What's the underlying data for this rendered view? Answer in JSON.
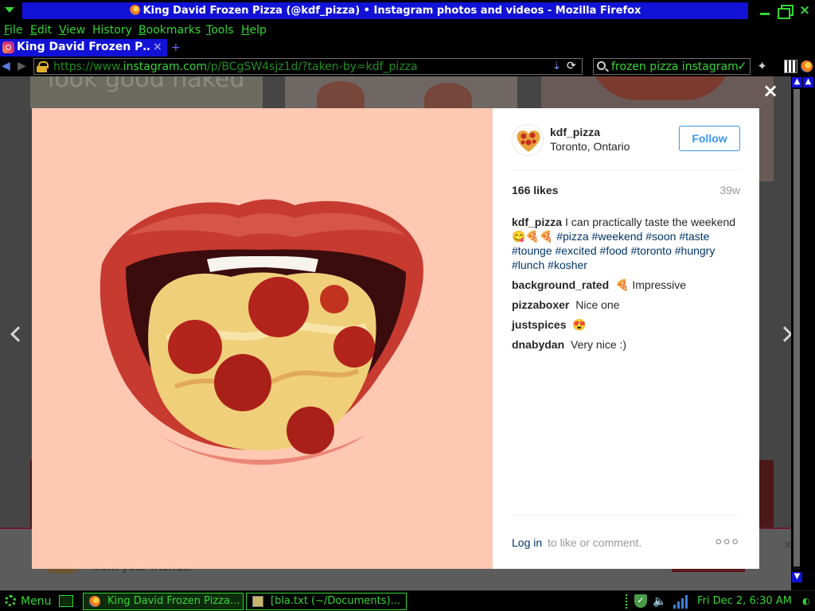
{
  "window": {
    "title": "King David Frozen Pizza (@kdf_pizza) • Instagram photos and videos - Mozilla Firefox"
  },
  "menubar": {
    "items": [
      {
        "label": "File",
        "accel": "F",
        "rest": "ile"
      },
      {
        "label": "Edit",
        "accel": "E",
        "rest": "dit"
      },
      {
        "label": "View",
        "accel": "V",
        "rest": "iew"
      },
      {
        "label": "History",
        "accel": "",
        "rest": "History"
      },
      {
        "label": "Bookmarks",
        "accel": "B",
        "rest": "ookmarks"
      },
      {
        "label": "Tools",
        "accel": "T",
        "rest": "ools"
      },
      {
        "label": "Help",
        "accel": "H",
        "rest": "elp"
      }
    ]
  },
  "tabs": {
    "active_title": "King David Frozen P…",
    "close_glyph": "×",
    "new_tab_glyph": "+"
  },
  "navbar": {
    "url_prefix": "https://www.",
    "url_host": "instagram.com",
    "url_path": "/p/BCgSW4sjz1d/?taken-by=kdf_pizza",
    "search_text": "frozen pizza instagram"
  },
  "background_page": {
    "left_tile_text": "look good naked\nand",
    "bottom_caption": "from your friends."
  },
  "post": {
    "username": "kdf_pizza",
    "location": "Toronto, Ontario",
    "follow_label": "Follow",
    "likes": "166 likes",
    "age": "39w",
    "caption": {
      "user": "kdf_pizza",
      "text": "I can practically taste the weekend 😋🍕🍕",
      "tags": [
        "#pizza",
        "#weekend",
        "#soon",
        "#taste",
        "#tounge",
        "#excited",
        "#food",
        "#toronto",
        "#hungry",
        "#lunch",
        "#kosher"
      ]
    },
    "comments": [
      {
        "user": "background_rated",
        "text": "🍕 Impressive"
      },
      {
        "user": "pizzaboxer",
        "text": "Nice one"
      },
      {
        "user": "justspices",
        "text": "😍"
      },
      {
        "user": "dnabydan",
        "text": "Very nice :)"
      }
    ],
    "login_link": "Log in",
    "login_rest": "to like or comment.",
    "more_glyph": "○○○"
  },
  "taskbar": {
    "menu_label": "Menu",
    "tasks": [
      {
        "label": "King David Frozen Pizza..."
      },
      {
        "label": "[bla.txt (~/Documents)..."
      }
    ],
    "clock": "Fri Dec  2,  6:30 AM"
  },
  "colors": {
    "accent_green": "#35d635",
    "title_blue": "#1212d6",
    "instagram_blue": "#3897f0",
    "hashtag_blue": "#003569",
    "image_background": "#ffc8b3"
  }
}
